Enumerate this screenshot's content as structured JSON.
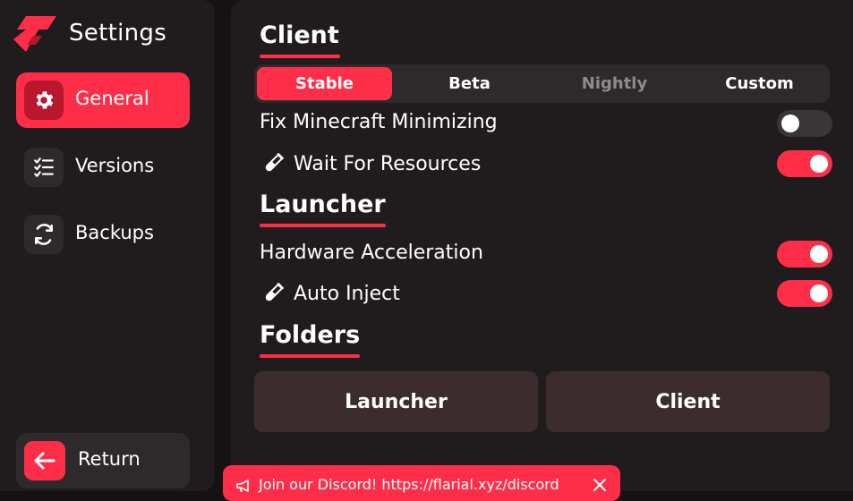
{
  "app": {
    "title": "Settings"
  },
  "sidebar": {
    "items": [
      {
        "label": "General",
        "icon": "gear-icon",
        "active": true
      },
      {
        "label": "Versions",
        "icon": "checklist-icon",
        "active": false
      },
      {
        "label": "Backups",
        "icon": "refresh-icon",
        "active": false
      }
    ],
    "return_label": "Return"
  },
  "client": {
    "title": "Client",
    "tabs": [
      {
        "label": "Stable",
        "active": true
      },
      {
        "label": "Beta",
        "active": false
      },
      {
        "label": "Nightly",
        "active": false
      },
      {
        "label": "Custom",
        "active": false
      }
    ],
    "options": [
      {
        "label": "Fix Minecraft Minimizing",
        "experimental": false,
        "enabled": false
      },
      {
        "label": "Wait For Resources",
        "experimental": true,
        "enabled": true
      }
    ]
  },
  "launcher": {
    "title": "Launcher",
    "options": [
      {
        "label": "Hardware Acceleration",
        "experimental": false,
        "enabled": true
      },
      {
        "label": "Auto Inject",
        "experimental": true,
        "enabled": true
      }
    ]
  },
  "folders": {
    "title": "Folders",
    "buttons": [
      {
        "label": "Launcher"
      },
      {
        "label": "Client"
      }
    ]
  },
  "toast": {
    "text": "Join our Discord! https://flarial.xyz/discord"
  },
  "colors": {
    "accent": "#ff2e48",
    "background": "#151213",
    "panel": "#201c1d",
    "control": "#2e2a2b",
    "folder_button": "#3d2c2e"
  }
}
